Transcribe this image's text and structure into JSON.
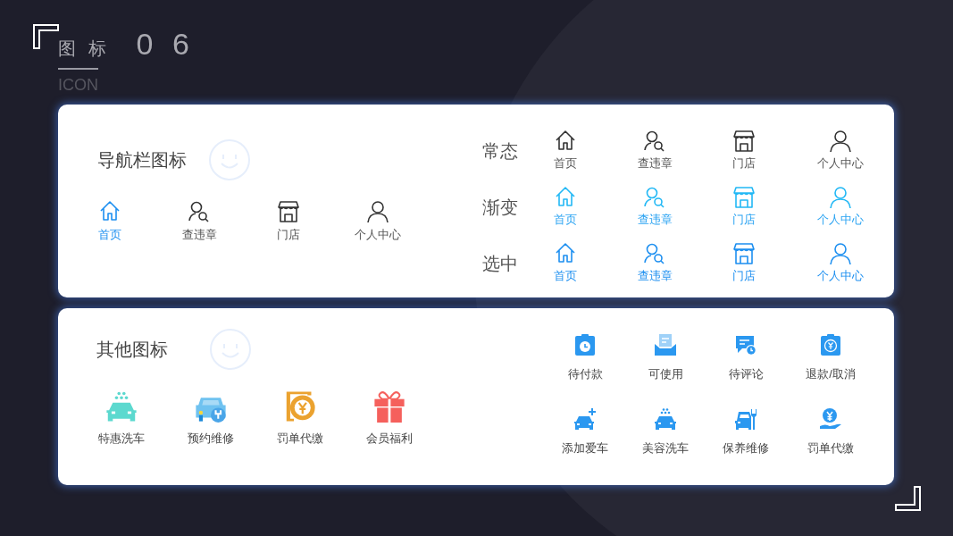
{
  "header": {
    "title": "图 标",
    "number": "0 6",
    "subtitle": "ICON"
  },
  "nav_card": {
    "title": "导航栏图标",
    "tab_bar": [
      {
        "label": "首页",
        "kind": "home",
        "selected": true
      },
      {
        "label": "查违章",
        "kind": "search-person",
        "selected": false
      },
      {
        "label": "门店",
        "kind": "store",
        "selected": false
      },
      {
        "label": "个人中心",
        "kind": "person",
        "selected": false
      }
    ],
    "state_rows": [
      {
        "label": "常态",
        "kind": "normal",
        "items": [
          {
            "label": "首页",
            "kind": "home"
          },
          {
            "label": "查违章",
            "kind": "search-person"
          },
          {
            "label": "门店",
            "kind": "store"
          },
          {
            "label": "个人中心",
            "kind": "person"
          }
        ]
      },
      {
        "label": "渐变",
        "kind": "gradient",
        "items": [
          {
            "label": "首页",
            "kind": "home"
          },
          {
            "label": "查违章",
            "kind": "search-person"
          },
          {
            "label": "门店",
            "kind": "store"
          },
          {
            "label": "个人中心",
            "kind": "person"
          }
        ]
      },
      {
        "label": "选中",
        "kind": "selected",
        "items": [
          {
            "label": "首页",
            "kind": "home"
          },
          {
            "label": "查违章",
            "kind": "search-person"
          },
          {
            "label": "门店",
            "kind": "store"
          },
          {
            "label": "个人中心",
            "kind": "person"
          }
        ]
      }
    ]
  },
  "other_card": {
    "title": "其他图标",
    "featured": [
      {
        "label": "特惠洗车",
        "kind": "car-wash",
        "color": "#5cd9cf"
      },
      {
        "label": "预约维修",
        "kind": "car-repair",
        "color": "#6fc2f0"
      },
      {
        "label": "罚单代缴",
        "kind": "ticket",
        "color": "#eba22f"
      },
      {
        "label": "会员福利",
        "kind": "gift",
        "color": "#f5605c"
      }
    ],
    "grid": [
      {
        "label": "待付款",
        "kind": "clipboard-clock"
      },
      {
        "label": "可使用",
        "kind": "inbox"
      },
      {
        "label": "待评论",
        "kind": "chat-clock"
      },
      {
        "label": "退款/取消",
        "kind": "clipboard-yuan"
      },
      {
        "label": "添加爱车",
        "kind": "car-plus"
      },
      {
        "label": "美容洗车",
        "kind": "car-wash"
      },
      {
        "label": "保养维修",
        "kind": "car-wrench"
      },
      {
        "label": "罚单代缴",
        "kind": "hand-coin"
      }
    ]
  }
}
